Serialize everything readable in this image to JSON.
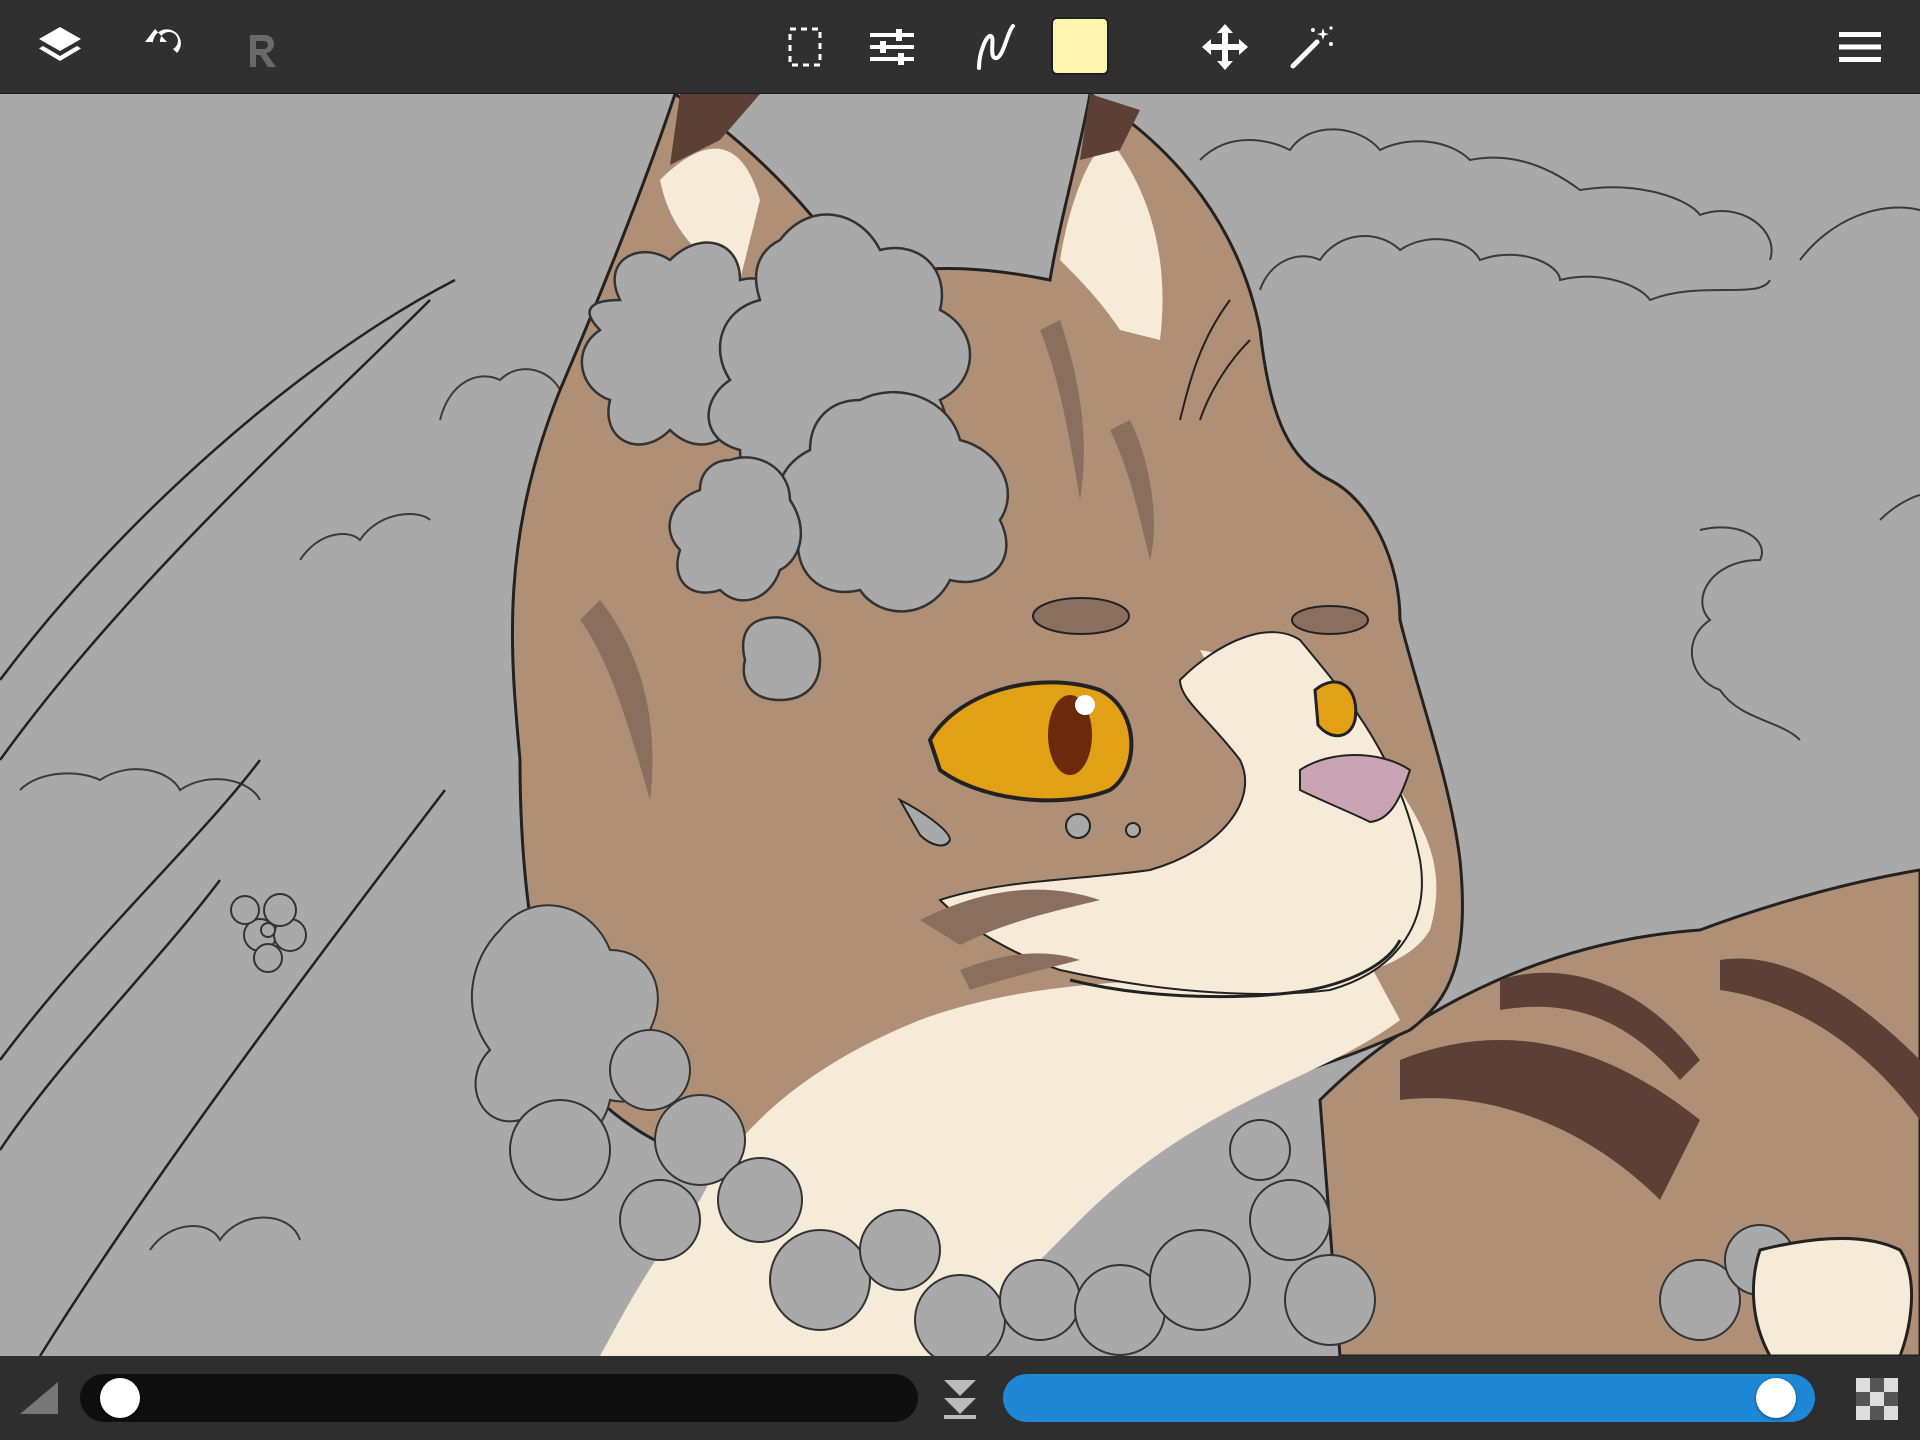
{
  "app": {
    "title": ""
  },
  "colors": {
    "toolbar_bg": "#303030",
    "icon": "#ffffff",
    "icon_disabled": "#6a6a6a",
    "current_color": "#fff4b0",
    "canvas_bg": "#a9a9a9",
    "opacity_slider": "#1f88d6",
    "size_slider": "#0f0f0f"
  },
  "toolbar": {
    "left": [
      {
        "name": "layers-button",
        "icon": "layers-icon",
        "enabled": true
      },
      {
        "name": "undo-button",
        "icon": "undo-icon",
        "enabled": true
      },
      {
        "name": "redo-button",
        "icon": "redo-icon",
        "enabled": false
      }
    ],
    "center": [
      {
        "name": "selection-tool",
        "icon": "marquee-select-icon"
      },
      {
        "name": "adjustments-button",
        "icon": "sliders-icon"
      },
      {
        "name": "brush-tool",
        "icon": "brush-stroke-icon"
      },
      {
        "name": "color-swatch",
        "icon": "color-swatch"
      },
      {
        "name": "move-tool",
        "icon": "move-arrows-icon"
      },
      {
        "name": "magic-wand-tool",
        "icon": "magic-wand-icon"
      }
    ],
    "right": [
      {
        "name": "menu-button",
        "icon": "hamburger-menu-icon"
      }
    ]
  },
  "canvas": {
    "artwork": "cat-illustration-with-flowers"
  },
  "bottom_bar": {
    "brush_size": {
      "icon": "brush-size-wedge-icon",
      "value": 0.02
    },
    "layer_icon": "flatten-down-icon",
    "opacity": {
      "icon": "transparency-checker-icon",
      "value": 0.98
    }
  }
}
